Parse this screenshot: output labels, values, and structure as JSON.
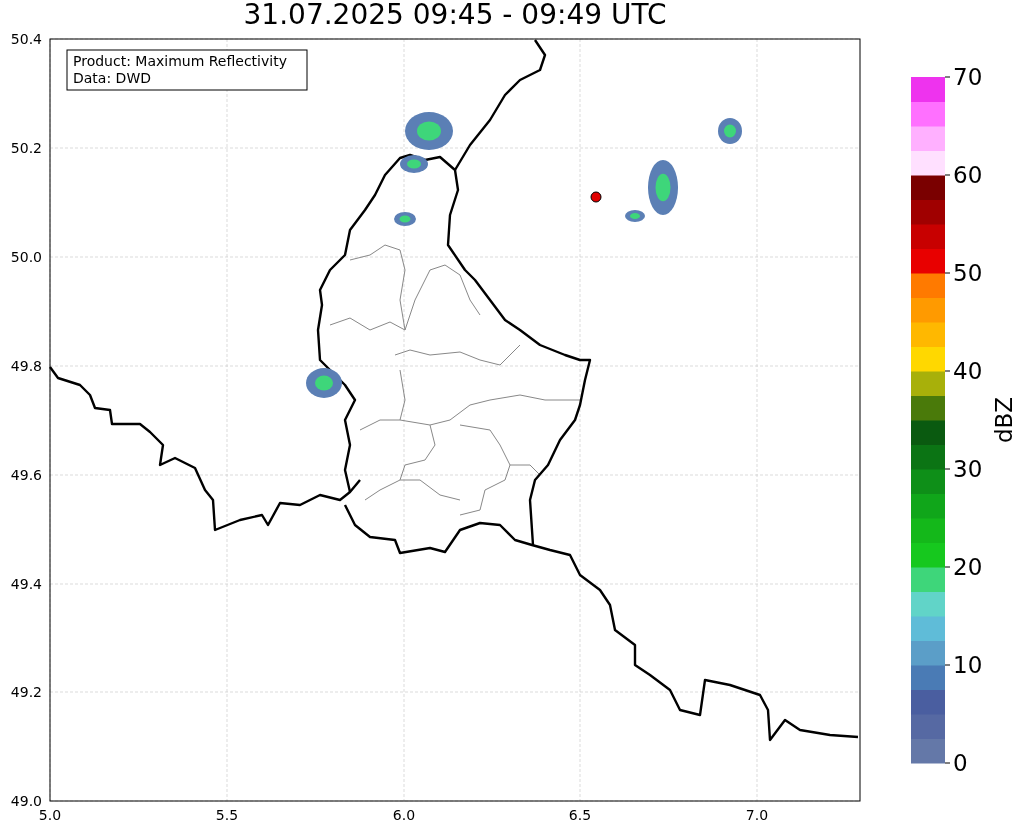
{
  "title": "31.07.2025 09:45 - 09:49 UTC",
  "legend": {
    "lines": [
      "Product: Maximum Reflectivity",
      "Data: DWD"
    ]
  },
  "x_ticks": [
    "5.0",
    "5.5",
    "6.0",
    "6.5",
    "7.0"
  ],
  "y_ticks": [
    "50.4",
    "50.2",
    "50.0",
    "49.8",
    "49.6",
    "49.4",
    "49.2",
    "49.0"
  ],
  "colorbar": {
    "label": "dBZ",
    "ticks": [
      "70",
      "60",
      "50",
      "40",
      "30",
      "20",
      "10",
      "0"
    ]
  }
}
